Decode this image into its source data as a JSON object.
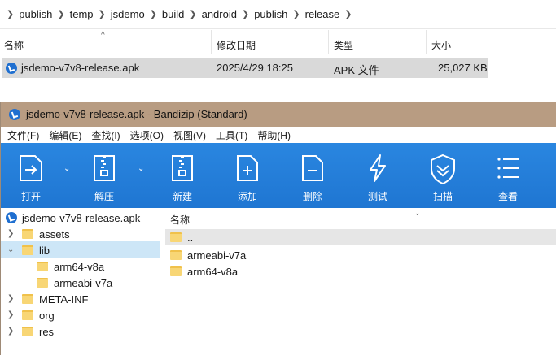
{
  "explorer": {
    "breadcrumb": [
      "publish",
      "temp",
      "jsdemo",
      "build",
      "android",
      "publish",
      "release"
    ],
    "columns": {
      "name": "名称",
      "modified": "修改日期",
      "type": "类型",
      "size": "大小"
    },
    "sort_indicator": "^",
    "file": {
      "name": "jsdemo-v7v8-release.apk",
      "modified": "2025/4/29 18:25",
      "type": "APK 文件",
      "size": "25,027 KB"
    }
  },
  "bandizip": {
    "title": "jsdemo-v7v8-release.apk - Bandizip (Standard)",
    "menu": [
      "文件(F)",
      "编辑(E)",
      "查找(I)",
      "选项(O)",
      "视图(V)",
      "工具(T)",
      "帮助(H)"
    ],
    "toolbar": [
      "打开",
      "解压",
      "新建",
      "添加",
      "删除",
      "测试",
      "扫描",
      "查看"
    ],
    "tree": {
      "root": "jsdemo-v7v8-release.apk",
      "items": [
        "assets",
        "lib",
        "arm64-v8a",
        "armeabi-v7a",
        "META-INF",
        "org",
        "res"
      ]
    },
    "list": {
      "header": "名称",
      "rows": [
        "..",
        "armeabi-v7a",
        "arm64-v8a"
      ]
    }
  },
  "colors": {
    "toolbar": "#2a86e0",
    "title_bar": "#b89c82",
    "tree_selection": "#cde6f7",
    "row_selection": "#d9d9d9"
  }
}
